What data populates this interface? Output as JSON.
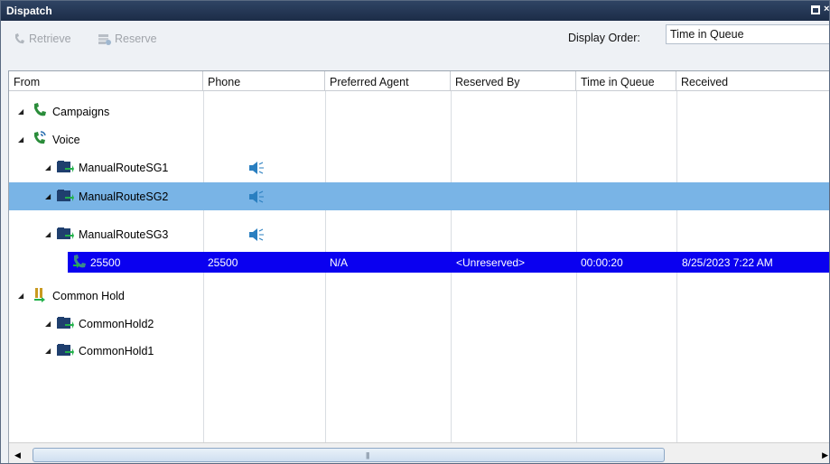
{
  "window": {
    "title": "Dispatch",
    "title_button_icons": [
      "maximize-icon",
      "close-icon"
    ]
  },
  "toolbar": {
    "retrieve_label": "Retrieve",
    "reserve_label": "Reserve",
    "display_order_label": "Display Order:",
    "display_order_value": "Time in Queue"
  },
  "grid": {
    "columns": [
      "From",
      "Phone",
      "Preferred Agent",
      "Reserved By",
      "Time in Queue",
      "Received"
    ],
    "rows": [
      {
        "from": "Campaigns",
        "icon": "phone-handset-icon",
        "level": 0,
        "expanded": true
      },
      {
        "from": "Voice",
        "icon": "phone-voice-icon",
        "level": 0,
        "expanded": true
      },
      {
        "from": "ManualRouteSG1",
        "icon": "queue-folder-icon",
        "level": 1,
        "expanded": true,
        "phone_icon": "speaker-icon"
      },
      {
        "from": "ManualRouteSG2",
        "icon": "queue-folder-icon",
        "level": 1,
        "expanded": true,
        "phone_icon": "speaker-icon",
        "selected": "light"
      },
      {
        "from": "ManualRouteSG3",
        "icon": "queue-folder-icon",
        "level": 1,
        "expanded": true,
        "phone_icon": "speaker-icon"
      },
      {
        "from": "25500",
        "phone": "25500",
        "preferred_agent": "N/A",
        "reserved_by": "<Unreserved>",
        "time_in_queue": "00:00:20",
        "received": "8/25/2023 7:22 AM",
        "icon": "call-item-icon",
        "level": 2,
        "selected": "dark"
      },
      {
        "from": "Common Hold",
        "icon": "hold-icon",
        "level": 0,
        "expanded": true
      },
      {
        "from": "CommonHold2",
        "icon": "queue-folder-icon",
        "level": 1,
        "expanded": true
      },
      {
        "from": "CommonHold1",
        "icon": "queue-folder-icon",
        "level": 1,
        "expanded": true
      }
    ]
  },
  "colors": {
    "titlebar": "#1c2c47",
    "selection_light": "#79b4e6",
    "selection_dark": "#0a00f0",
    "speaker": "#2a7fc0"
  }
}
